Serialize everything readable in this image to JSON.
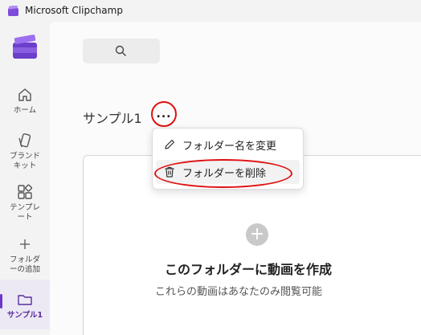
{
  "app": {
    "title": "Microsoft Clipchamp"
  },
  "sidebar": {
    "items": [
      {
        "label": "ホーム",
        "icon": "home-icon"
      },
      {
        "label": "ブランド\nキット",
        "icon": "brand-kit-icon"
      },
      {
        "label": "テンプレ\nート",
        "icon": "template-icon"
      },
      {
        "label": "フォルダ\nーの追加",
        "icon": "add-folder-icon"
      },
      {
        "label": "サンプル1",
        "icon": "folder-icon",
        "active": true
      }
    ]
  },
  "search": {
    "icon": "search-icon"
  },
  "folder": {
    "name": "サンプル1",
    "more_label": "..."
  },
  "context_menu": {
    "items": [
      {
        "label": "フォルダー名を変更",
        "icon": "pencil-icon"
      },
      {
        "label": "フォルダーを削除",
        "icon": "trash-icon"
      }
    ]
  },
  "empty_state": {
    "title": "このフォルダーに動画を作成",
    "subtitle": "これらの動画はあなたのみ閲覧可能",
    "plus": "+"
  },
  "colors": {
    "accent": "#6e36c8",
    "annotation": "#e01010"
  }
}
